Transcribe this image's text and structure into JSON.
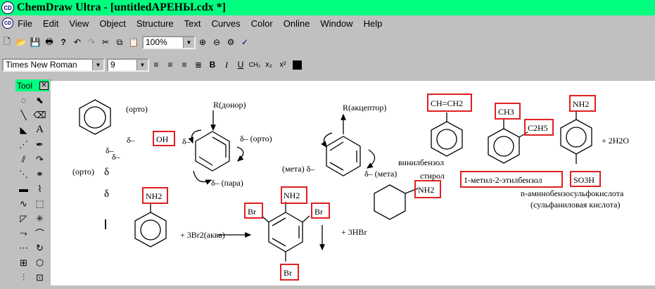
{
  "window": {
    "title": "ChemDraw Ultra - [untitledAPEHЫ.cdx *]",
    "app_icon": "cd-logo"
  },
  "menu": {
    "items": [
      "File",
      "Edit",
      "View",
      "Object",
      "Structure",
      "Text",
      "Curves",
      "Color",
      "Online",
      "Window",
      "Help"
    ]
  },
  "toolbar": {
    "zoom": "100%"
  },
  "format_bar": {
    "font": "Times New Roman",
    "size": "9"
  },
  "palette": {
    "title": "Tool",
    "close": "✕"
  },
  "canvas": {
    "t_orto1": "(орто)",
    "t_delta_oh": "δ–",
    "t_oh": "OH",
    "t_delta1": "δ–",
    "t_delta2": "δ–",
    "t_orto2": "(орто)",
    "t_delta3": "δ",
    "t_delta4": "δ",
    "t_donor": "R(донор)",
    "t_donor_delta_orto": "δ– (орто)",
    "t_donor_delta_left": "δ–",
    "t_donor_para": "δ– (пара)",
    "t_acceptor": "R(акцептор)",
    "t_meta_left": "(мета) δ–",
    "t_meta_right": "δ– (мета)",
    "t_vinyl_group": "CH=CH2",
    "t_vinyl_name1": "винилбензол",
    "t_vinyl_name2": "стирол",
    "t_ch3": "CH3",
    "t_c2h5": "C2H5",
    "t_ethyl_name": "1-метил-2-этилбензол",
    "t_nh2_sulf": "NH2",
    "t_so3h": "SO3H",
    "t_plus_water": "+   2H2O",
    "t_sulf_name1": "n-аминобензосульфокислота",
    "t_sulf_name2": "(сульфаниловая кислота)",
    "t_nh2_cyc": "NH2",
    "t_nh2_aniline": "NH2",
    "t_plus_br2": "+   3Br2(аква)",
    "t_nh2_prod": "NH2",
    "t_br_left": "Br",
    "t_br_right": "Br",
    "t_br_bottom": "Br",
    "t_plus_hbr": "+   3HBr"
  }
}
